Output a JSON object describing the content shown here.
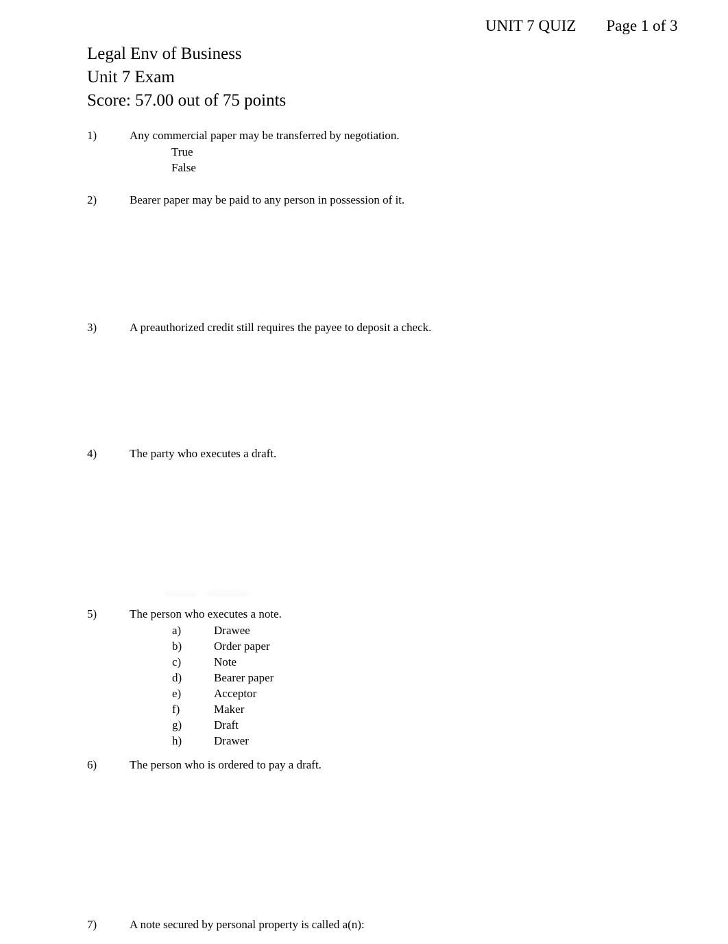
{
  "header": {
    "quiz_label": "UNIT 7 QUIZ",
    "page_label": "Page 1 of 3"
  },
  "title": {
    "course": "Legal Env of Business",
    "exam": "Unit 7 Exam",
    "score": "Score:  57.00 out of 75 points"
  },
  "questions": [
    {
      "number": "1)",
      "text": "Any commercial paper may be transferred by negotiation.",
      "gap_before": 0,
      "gap_after": 24,
      "options": [
        {
          "letter": "",
          "text": "True"
        },
        {
          "letter": "",
          "text": "False"
        }
      ]
    },
    {
      "number": "2)",
      "text": "Bearer paper may be paid to any person in possession of it.",
      "gap_before": 0,
      "gap_after": 162,
      "options": []
    },
    {
      "number": "3)",
      "text": "A preauthorized credit still requires the payee to deposit a check.",
      "gap_before": 0,
      "gap_after": 160,
      "options": []
    },
    {
      "number": "4)",
      "text": "The party who executes a draft.",
      "gap_before": 0,
      "gap_after": 210,
      "options": []
    },
    {
      "number": "5)",
      "text": "The person who executes a note.",
      "gap_before": 0,
      "gap_after": 12,
      "options": [
        {
          "letter": "a)",
          "text": "Drawee"
        },
        {
          "letter": "b)",
          "text": "Order paper"
        },
        {
          "letter": "c)",
          "text": "Note"
        },
        {
          "letter": "d)",
          "text": "Bearer paper"
        },
        {
          "letter": "e)",
          "text": "Acceptor"
        },
        {
          "letter": "f)",
          "text": "Maker"
        },
        {
          "letter": "g)",
          "text": "Draft"
        },
        {
          "letter": "h)",
          "text": "Drawer"
        }
      ]
    },
    {
      "number": "6)",
      "text": "The person who is ordered to pay a draft.",
      "gap_before": 0,
      "gap_after": 209,
      "options": []
    },
    {
      "number": "7)",
      "text": "A note secured by personal property is called a(n):",
      "gap_before": 0,
      "gap_after": 0,
      "options": []
    }
  ]
}
